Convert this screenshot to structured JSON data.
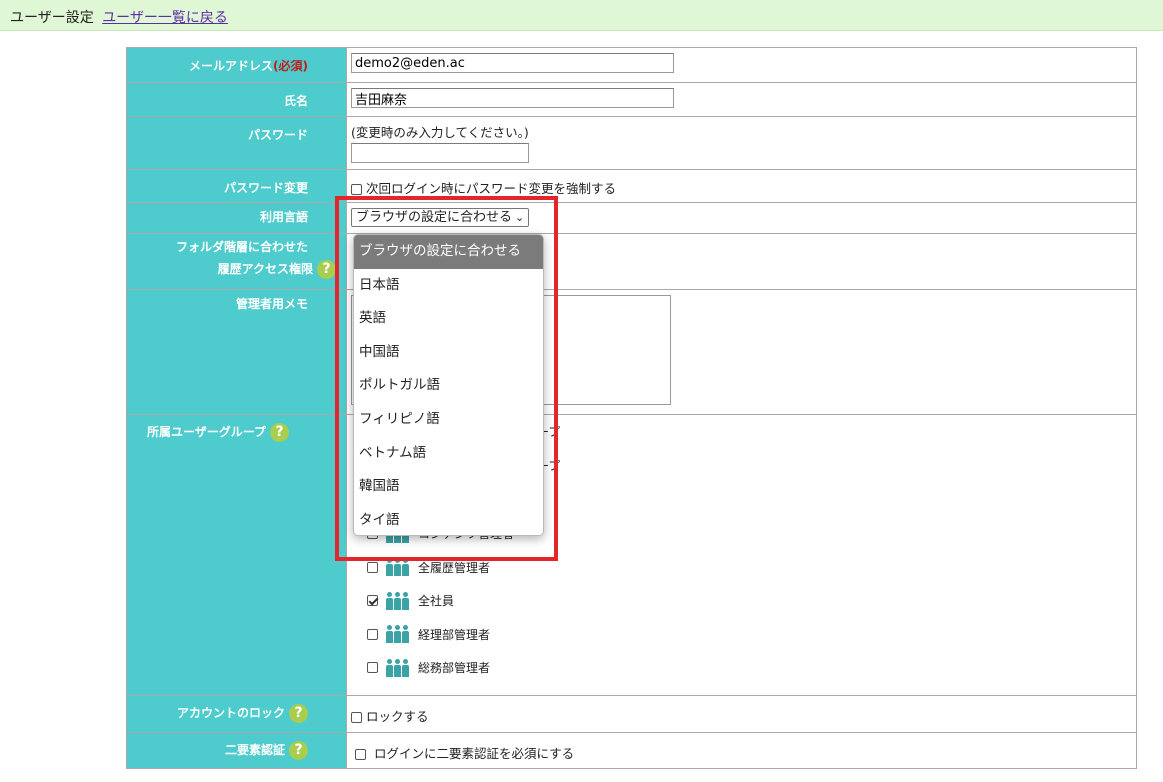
{
  "header": {
    "title": "ユーザー設定",
    "back_link": "ユーザー一覧に戻る"
  },
  "fields": {
    "email": {
      "label": "メールアドレス",
      "required": "(必須)",
      "value": "demo2@eden.ac"
    },
    "name": {
      "label": "氏名",
      "value": "吉田麻奈"
    },
    "password": {
      "label": "パスワード",
      "hint": "(変更時のみ入力してください。)",
      "value": ""
    },
    "password_change": {
      "label": "パスワード変更",
      "checkbox_label": "次回ログイン時にパスワード変更を強制する",
      "checked": false
    },
    "language": {
      "label": "利用言語",
      "selected": "ブラウザの設定に合わせる"
    },
    "folder_access": {
      "label_line1": "フォルダ階層に合わせた",
      "label_line2": "履歴アクセス権限"
    },
    "admin_memo": {
      "label": "管理者用メモ",
      "value": ""
    },
    "user_groups": {
      "label": "所属ユーザーグループ",
      "partial_1": "ープ",
      "partial_2": "ープ",
      "items": [
        {
          "name": "コンテンツ管理者",
          "checked": false
        },
        {
          "name": "全履歴管理者",
          "checked": false
        },
        {
          "name": "全社員",
          "checked": true
        },
        {
          "name": "経理部管理者",
          "checked": false
        },
        {
          "name": "総務部管理者",
          "checked": false
        }
      ]
    },
    "account_lock": {
      "label": "アカウントのロック",
      "checkbox_label": "ロックする",
      "checked": false
    },
    "two_factor": {
      "label": "二要素認証",
      "checkbox_label": "ログインに二要素認証を必須にする",
      "checked": false
    }
  },
  "language_dropdown": {
    "options": [
      "ブラウザの設定に合わせる",
      "日本語",
      "英語",
      "中国語",
      "ポルトガル語",
      "フィリピノ語",
      "ベトナム語",
      "韓国語",
      "タイ語"
    ],
    "highlighted_index": 0
  },
  "icons": {
    "help": "question-mark-icon",
    "group": "people-icon"
  },
  "colors": {
    "label_bg": "#4ecbcd",
    "highlight_box": "#e3262c",
    "header_bg": "#e0f7d6",
    "help_icon": "#a9cd4e"
  }
}
